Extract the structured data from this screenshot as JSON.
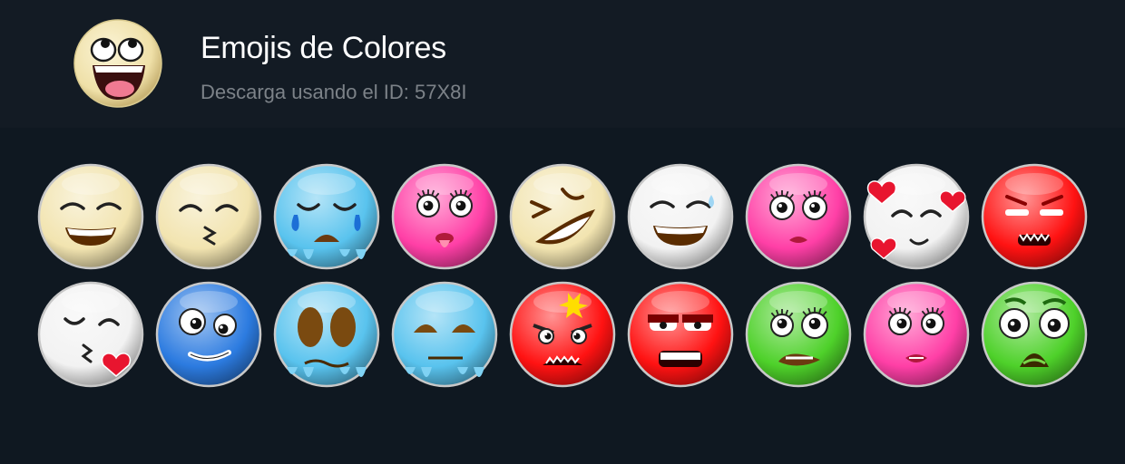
{
  "pack": {
    "title": "Emojis de Colores",
    "subtitle": "Descarga usando el ID: 57X8I",
    "icon": "awesome-face-icon"
  },
  "emojis": [
    {
      "name": "grinning-smiling-eyes-emoji",
      "base": "#f2e4b0"
    },
    {
      "name": "kissing-smiling-eyes-emoji",
      "base": "#f2e4b0"
    },
    {
      "name": "cold-face-tears-emoji",
      "base": "#59c3ee"
    },
    {
      "name": "pink-tongue-out-emoji",
      "base": "#ff3fa6"
    },
    {
      "name": "laughing-squinting-emoji",
      "base": "#f2e4b0"
    },
    {
      "name": "white-grinning-sweat-emoji",
      "base": "#f2f2f2"
    },
    {
      "name": "pink-surprised-lips-emoji",
      "base": "#ff3fa6"
    },
    {
      "name": "white-smiling-hearts-emoji",
      "base": "#f2f2f2"
    },
    {
      "name": "red-angry-teeth-emoji",
      "base": "#ff1212"
    },
    {
      "name": "white-kiss-heart-emoji",
      "base": "#f2f2f2"
    },
    {
      "name": "blue-grimacing-emoji",
      "base": "#2c7be0"
    },
    {
      "name": "cold-big-eyes-emoji",
      "base": "#59c3ee"
    },
    {
      "name": "cold-unamused-emoji",
      "base": "#59c3ee"
    },
    {
      "name": "red-anger-symbol-emoji",
      "base": "#ff1212"
    },
    {
      "name": "red-tired-teeth-emoji",
      "base": "#ff1212"
    },
    {
      "name": "green-nauseated-emoji",
      "base": "#4ed12a"
    },
    {
      "name": "pink-lip-bite-emoji",
      "base": "#ff3fa6"
    },
    {
      "name": "green-zombie-emoji",
      "base": "#4ed12a"
    }
  ]
}
